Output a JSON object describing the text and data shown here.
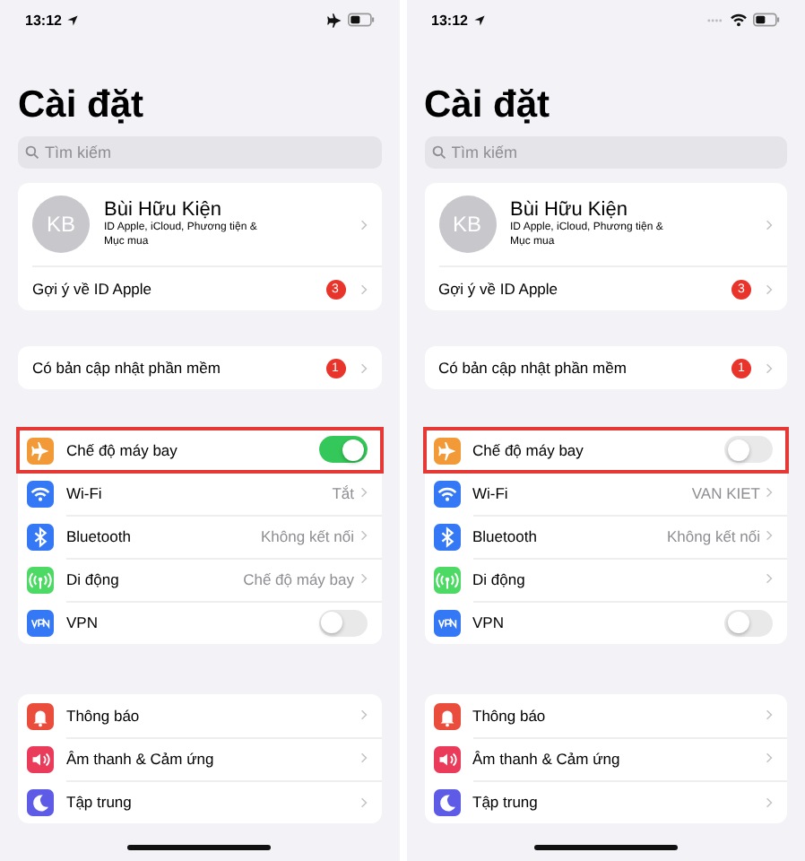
{
  "phones": [
    {
      "status_bar": {
        "time": "13:12"
      },
      "title": "Cài đặt",
      "search": {
        "placeholder": "Tìm kiếm"
      },
      "profile": {
        "initials": "KB",
        "name": "Bùi Hữu Kiện",
        "subtitle": "ID Apple, iCloud, Phương tiện & Mục mua"
      },
      "apple_id_row": {
        "label": "Gợi ý về ID Apple",
        "badge": "3"
      },
      "update_row": {
        "label": "Có bản cập nhật phần mềm",
        "badge": "1"
      },
      "network": [
        {
          "kind": "toggle",
          "label": "Chế độ máy bay",
          "on": true,
          "highlighted": true
        },
        {
          "kind": "link",
          "label": "Wi-Fi",
          "value": "Tắt",
          "highlighted": false
        },
        {
          "kind": "link",
          "label": "Bluetooth",
          "value": "Không kết nối",
          "highlighted": false
        },
        {
          "kind": "link",
          "label": "Di động",
          "value": "Chế độ máy bay",
          "highlighted": false
        },
        {
          "kind": "toggle",
          "label": "VPN",
          "on": false,
          "highlighted": false
        }
      ],
      "general": [
        {
          "kind": "link",
          "label": "Thông báo",
          "highlighted": false
        },
        {
          "kind": "link",
          "label": "Âm thanh & Cảm ứng",
          "highlighted": false
        },
        {
          "kind": "link",
          "label": "Tập trung",
          "highlighted": false
        }
      ]
    },
    {
      "status_bar": {
        "time": "13:12"
      },
      "title": "Cài đặt",
      "search": {
        "placeholder": "Tìm kiếm"
      },
      "profile": {
        "initials": "KB",
        "name": "Bùi Hữu Kiện",
        "subtitle": "ID Apple, iCloud, Phương tiện & Mục mua"
      },
      "apple_id_row": {
        "label": "Gợi ý về ID Apple",
        "badge": "3"
      },
      "update_row": {
        "label": "Có bản cập nhật phần mềm",
        "badge": "1"
      },
      "network": [
        {
          "kind": "toggle",
          "label": "Chế độ máy bay",
          "on": false,
          "highlighted": true
        },
        {
          "kind": "link",
          "label": "Wi-Fi",
          "value": "VAN KIET",
          "highlighted": false
        },
        {
          "kind": "link",
          "label": "Bluetooth",
          "value": "Không kết nối",
          "highlighted": false
        },
        {
          "kind": "link",
          "label": "Di động",
          "highlighted": false
        },
        {
          "kind": "toggle",
          "label": "VPN",
          "on": false,
          "highlighted": false
        }
      ],
      "general": [
        {
          "kind": "link",
          "label": "Thông báo",
          "highlighted": false
        },
        {
          "kind": "link",
          "label": "Âm thanh & Cảm ứng",
          "highlighted": false
        },
        {
          "kind": "link",
          "label": "Tập trung",
          "highlighted": false
        }
      ]
    }
  ]
}
